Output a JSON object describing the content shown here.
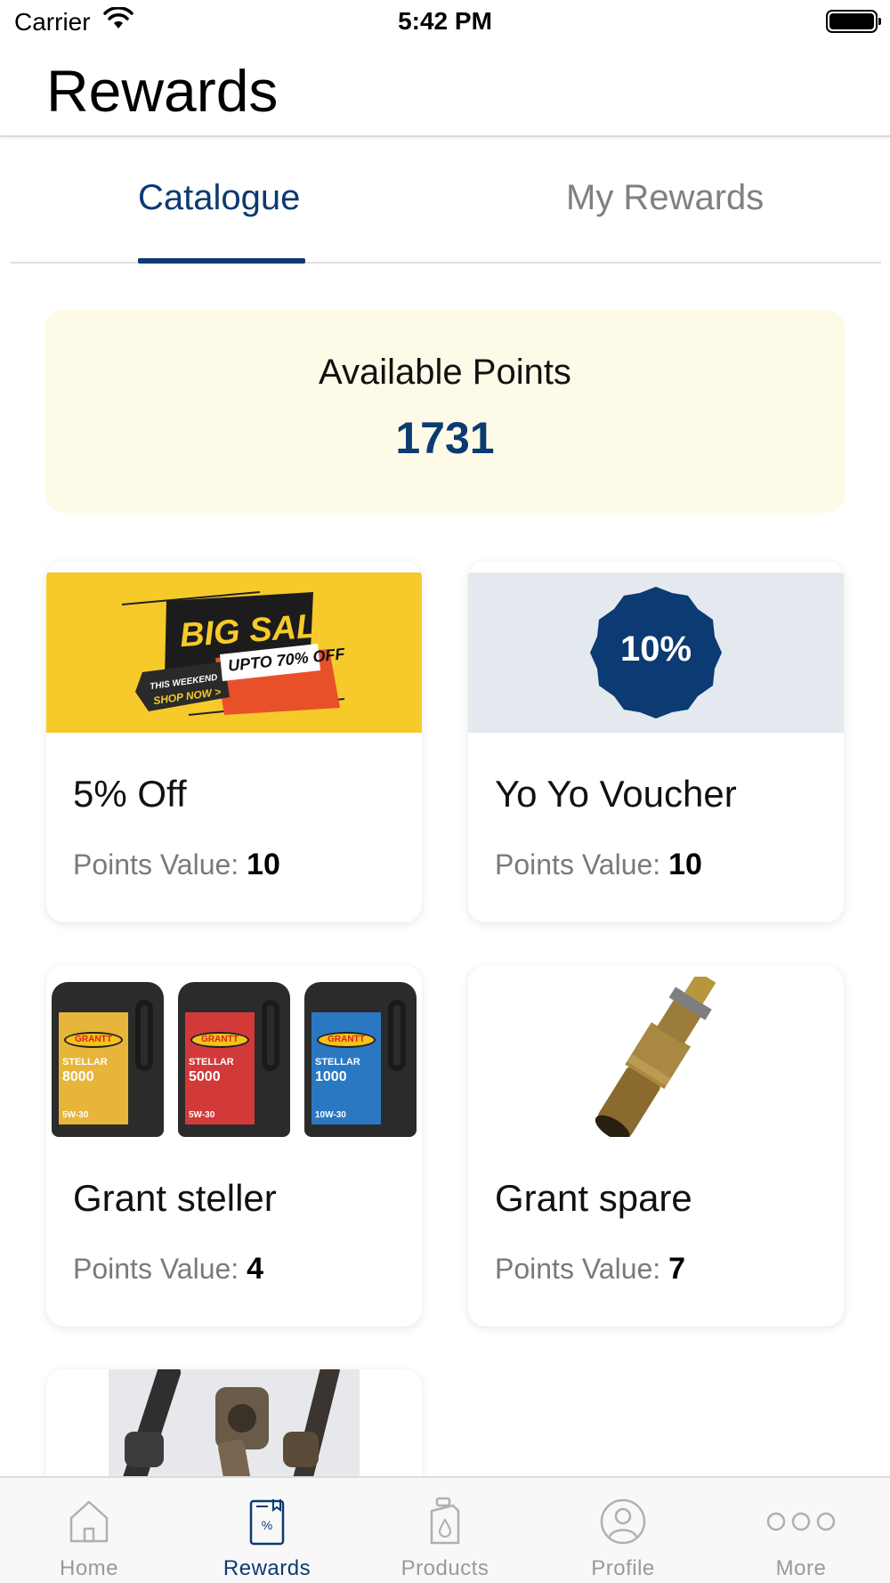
{
  "status": {
    "carrier": "Carrier",
    "time": "5:42 PM"
  },
  "header": {
    "title": "Rewards"
  },
  "tabs": [
    {
      "label": "Catalogue",
      "active": true
    },
    {
      "label": "My Rewards",
      "active": false
    }
  ],
  "points": {
    "label": "Available Points",
    "value": "1731"
  },
  "points_prefix": "Points Value:",
  "rewards": [
    {
      "title": "5% Off",
      "points": "10",
      "image": "big-sale-banner",
      "banner": {
        "big_sale": "BIG SALE",
        "upto": "UPTO 70% OFF",
        "this_weekend": "THIS WEEKEND",
        "shop_now": "SHOP NOW >"
      }
    },
    {
      "title": "Yo Yo Voucher",
      "points": "10",
      "image": "discount-badge",
      "badge": "10%"
    },
    {
      "title": "Grant steller",
      "points": "4",
      "image": "engine-oil-cans",
      "cans": [
        {
          "brand": "GRANTT",
          "name": "STELLAR",
          "model": "8000",
          "grade": "5W-30",
          "color": "#e6b53a"
        },
        {
          "brand": "GRANTT",
          "name": "STELLAR",
          "model": "5000",
          "grade": "5W-30",
          "color": "#d23a3a"
        },
        {
          "brand": "GRANTT",
          "name": "STELLAR",
          "model": "1000",
          "grade": "10W-30",
          "color": "#2a78c2"
        }
      ]
    },
    {
      "title": "Grant spare",
      "points": "7",
      "image": "brass-fitting"
    },
    {
      "title": "",
      "points": "",
      "image": "drive-shafts"
    }
  ],
  "tab_bar": [
    {
      "label": "Home",
      "icon": "home-icon",
      "active": false
    },
    {
      "label": "Rewards",
      "icon": "rewards-icon",
      "active": true
    },
    {
      "label": "Products",
      "icon": "products-icon",
      "active": false
    },
    {
      "label": "Profile",
      "icon": "profile-icon",
      "active": false
    },
    {
      "label": "More",
      "icon": "more-icon",
      "active": false
    }
  ],
  "colors": {
    "primary": "#0c3a72",
    "points_bg": "#fefae8",
    "inactive": "#9a9a9a",
    "sale_yellow": "#f6ca2a"
  }
}
